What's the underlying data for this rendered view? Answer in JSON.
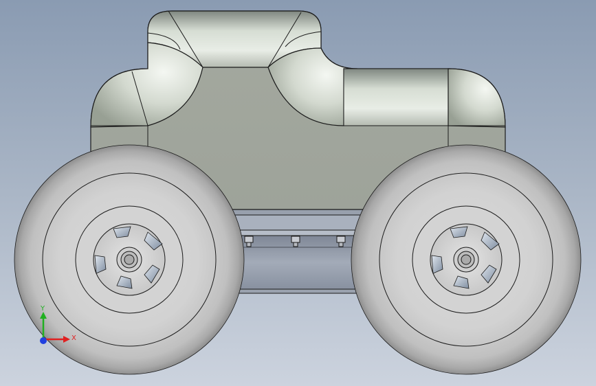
{
  "view": {
    "background_top": "#8a9bb2",
    "background_bottom": "#ccd3de"
  },
  "model": {
    "body_color": "#a3a89f",
    "body_highlight": "#e6ebe4",
    "tire_color": "#c6c6c6",
    "edge_color": "#1a1a1a"
  },
  "triad": {
    "x_label": "X",
    "y_label": "Y",
    "x_color": "#e02020",
    "y_color": "#20b020",
    "z_color": "#2040e0"
  }
}
